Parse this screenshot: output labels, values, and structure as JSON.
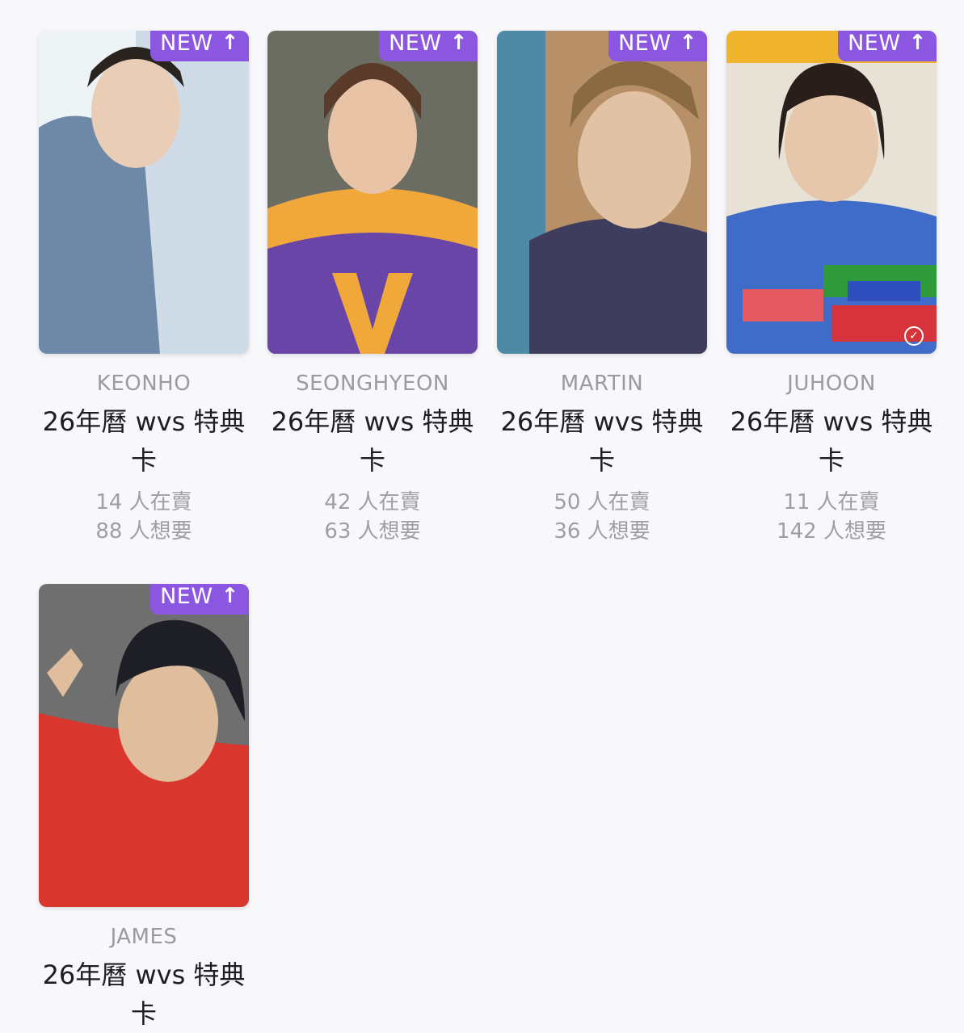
{
  "badge_label": "NEW",
  "badge_icon": "arrow-up-icon",
  "accent_color": "#8c57e0",
  "cards": [
    {
      "member": "KEONHO",
      "title": "26年曆 wvs 特典卡",
      "selling": "14 人在賣",
      "wanting": "88 人想要",
      "palette": [
        "#cfdce8",
        "#6e88a8",
        "#eef3f6"
      ]
    },
    {
      "member": "SEONGHYEON",
      "title": "26年曆 wvs 特典卡",
      "selling": "42 人在賣",
      "wanting": "63 人想要",
      "palette": [
        "#6b6d62",
        "#6a45a8",
        "#f0a83a"
      ]
    },
    {
      "member": "MARTIN",
      "title": "26年曆 wvs 特典卡",
      "selling": "50 人在賣",
      "wanting": "36 人想要",
      "palette": [
        "#b89068",
        "#3f3d5e",
        "#e2c2a4"
      ]
    },
    {
      "member": "JUHOON",
      "title": "26年曆 wvs 特典卡",
      "selling": "11 人在賣",
      "wanting": "142 人想要",
      "palette": [
        "#e8e2d6",
        "#3f6cc8",
        "#d6343a"
      ]
    },
    {
      "member": "JAMES",
      "title": "26年曆 wvs 特典卡",
      "selling": "",
      "wanting": "",
      "palette": [
        "#6f6f6f",
        "#d9362e",
        "#1e1e26"
      ]
    }
  ]
}
